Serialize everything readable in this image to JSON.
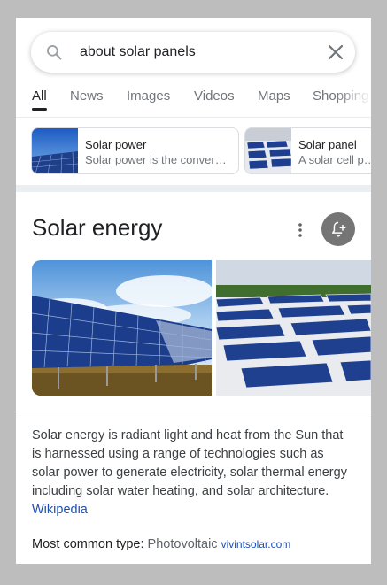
{
  "search": {
    "query": "about solar panels",
    "placeholder": ""
  },
  "tabs": [
    {
      "label": "All",
      "active": true
    },
    {
      "label": "News",
      "active": false
    },
    {
      "label": "Images",
      "active": false
    },
    {
      "label": "Videos",
      "active": false
    },
    {
      "label": "Maps",
      "active": false
    },
    {
      "label": "Shopping",
      "active": false
    }
  ],
  "related_cards": [
    {
      "title": "Solar power",
      "subtitle": "Solar power is the conversion of energy from sunlight"
    },
    {
      "title": "Solar panel",
      "subtitle": "A solar cell panel"
    }
  ],
  "knowledge_panel": {
    "title": "Solar energy",
    "description": "Solar energy is radiant light and heat from the Sun that is harnessed using a range of technologies such as solar power to generate electricity, solar thermal energy including solar water heating, and solar architecture.",
    "source": "Wikipedia",
    "common_type_label": "Most common type:",
    "common_type_value": "Photovoltaic",
    "common_type_source": "vivintsolar.com"
  },
  "icons": [
    "search-icon",
    "close-icon",
    "more-vert-icon",
    "add-alert-icon"
  ],
  "colors": {
    "link": "#1a4fb5",
    "follow_button": "#757575",
    "band": "#eceff1"
  }
}
